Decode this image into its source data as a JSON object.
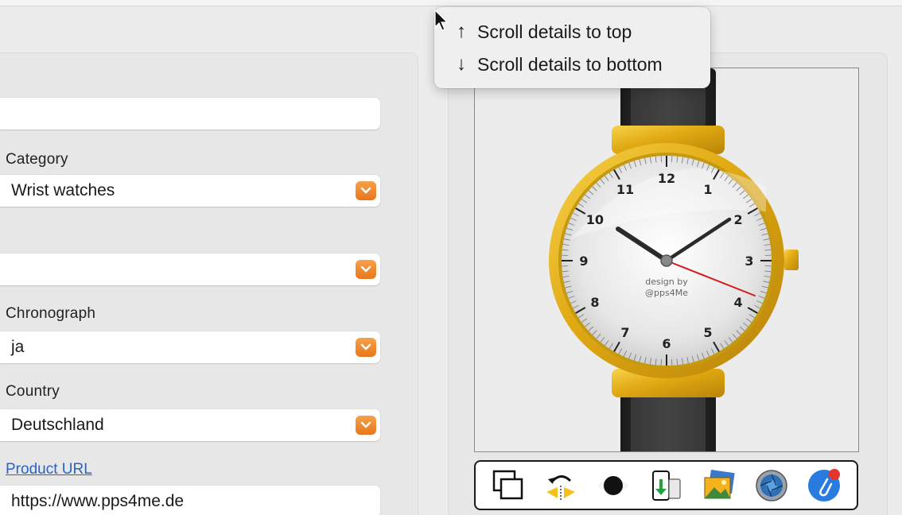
{
  "fields": {
    "category_label": "Category",
    "category_value": "Wrist watches",
    "chronograph_label": "Chronograph",
    "chronograph_value": "ja",
    "country_label": "Country",
    "country_value": "Deutschland",
    "product_url_label": "Product URL",
    "product_url_value": "https://www.pps4me.de"
  },
  "popup": {
    "scroll_top": "Scroll details to top",
    "scroll_bottom": "Scroll details to bottom"
  },
  "watch": {
    "credit_line1": "design by",
    "credit_line2": "@pps4Me",
    "numerals": [
      "12",
      "1",
      "2",
      "3",
      "4",
      "5",
      "6",
      "7",
      "8",
      "9",
      "10",
      "11"
    ]
  },
  "toolbar_icons": [
    "copy-image-icon",
    "flip-image-icon",
    "eye-icon",
    "export-phone-icon",
    "photos-icon",
    "camera-shutter-icon",
    "attachment-icon"
  ],
  "colors": {
    "accent_orange": "#ef8326",
    "link_blue": "#2a63c9"
  }
}
